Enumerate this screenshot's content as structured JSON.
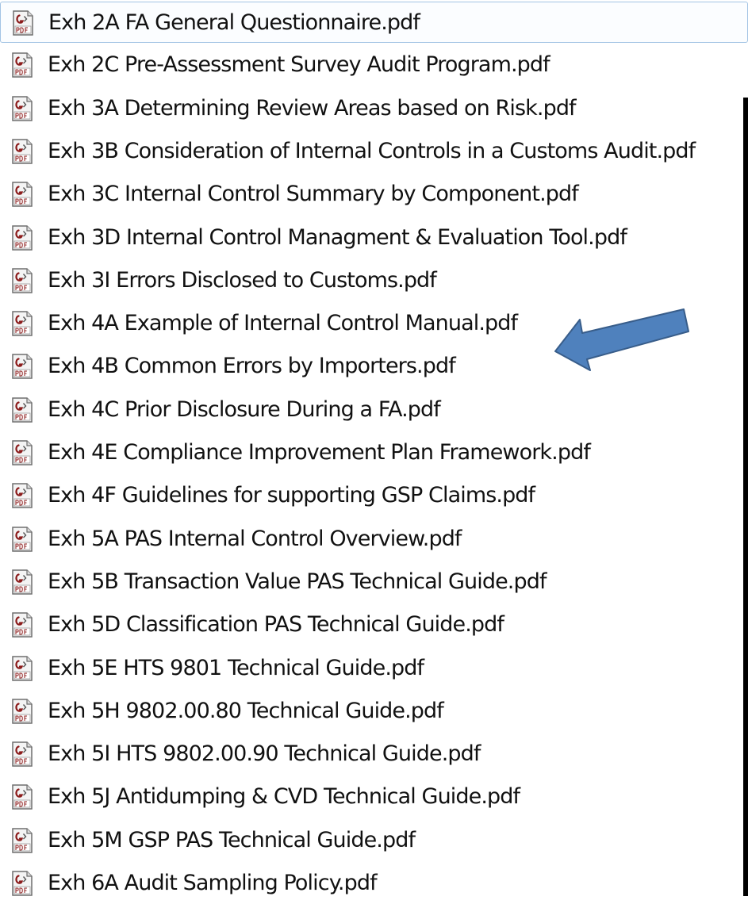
{
  "files": [
    {
      "name": "Exh 2A FA General Questionnaire.pdf",
      "icon": "pdf-file-icon",
      "selected": true
    },
    {
      "name": "Exh 2C Pre-Assessment Survey Audit Program.pdf",
      "icon": "pdf-file-icon"
    },
    {
      "name": "Exh 3A Determining Review Areas based on Risk.pdf",
      "icon": "pdf-file-icon"
    },
    {
      "name": "Exh 3B Consideration of Internal Controls in a Customs Audit.pdf",
      "icon": "pdf-file-icon"
    },
    {
      "name": "Exh 3C Internal Control Summary by Component.pdf",
      "icon": "pdf-file-icon"
    },
    {
      "name": "Exh 3D Internal Control Managment & Evaluation Tool.pdf",
      "icon": "pdf-file-icon"
    },
    {
      "name": "Exh 3I Errors Disclosed to Customs.pdf",
      "icon": "pdf-file-icon"
    },
    {
      "name": "Exh 4A Example of Internal Control Manual.pdf",
      "icon": "pdf-file-icon"
    },
    {
      "name": "Exh 4B Common Errors by Importers.pdf",
      "icon": "pdf-file-icon"
    },
    {
      "name": "Exh 4C Prior Disclosure During a FA.pdf",
      "icon": "pdf-file-icon"
    },
    {
      "name": "Exh 4E Compliance Improvement Plan Framework.pdf",
      "icon": "pdf-file-icon"
    },
    {
      "name": "Exh 4F Guidelines for supporting GSP Claims.pdf",
      "icon": "pdf-file-icon"
    },
    {
      "name": "Exh 5A PAS Internal Control Overview.pdf",
      "icon": "pdf-file-icon"
    },
    {
      "name": "Exh 5B Transaction Value PAS Technical Guide.pdf",
      "icon": "pdf-file-icon"
    },
    {
      "name": "Exh 5D Classification PAS Technical Guide.pdf",
      "icon": "pdf-file-icon"
    },
    {
      "name": "Exh 5E HTS 9801 Technical Guide.pdf",
      "icon": "pdf-file-icon"
    },
    {
      "name": "Exh 5H 9802.00.80 Technical Guide.pdf",
      "icon": "pdf-file-icon"
    },
    {
      "name": "Exh 5I HTS 9802.00.90 Technical Guide.pdf",
      "icon": "pdf-file-icon"
    },
    {
      "name": "Exh 5J Antidumping & CVD  Technical Guide.pdf",
      "icon": "pdf-file-icon"
    },
    {
      "name": "Exh 5M  GSP PAS Technical Guide.pdf",
      "icon": "pdf-file-icon"
    },
    {
      "name": "Exh 6A Audit Sampling Policy.pdf",
      "icon": "pdf-file-icon"
    }
  ],
  "colors": {
    "arrow_fill": "#4f81bd",
    "arrow_stroke": "#385d8a",
    "selection_border": "#a3c4e4",
    "text": "#111111"
  }
}
